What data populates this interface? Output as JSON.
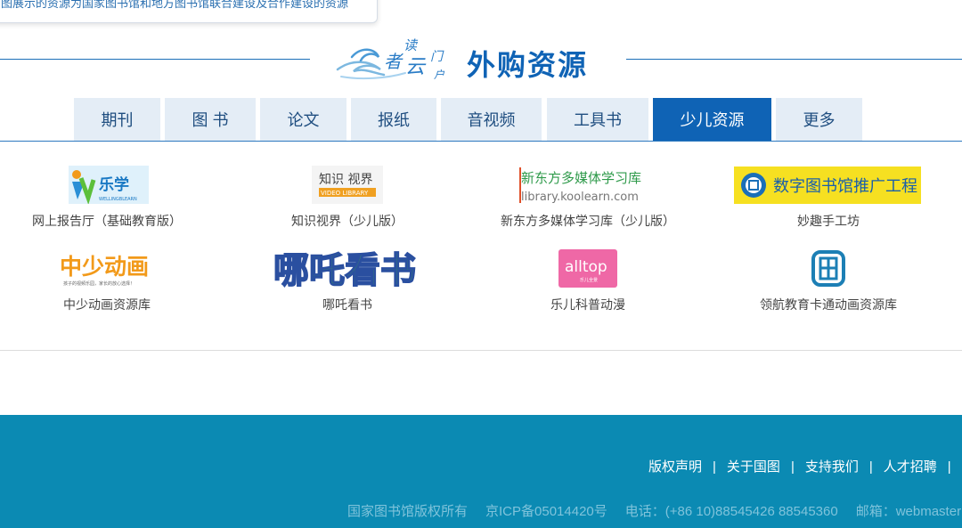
{
  "notice": {
    "text": "图展示的资源为国家图书馆和地方图书馆联合建设及合作建设的资源"
  },
  "header": {
    "logo_text": "读者之门",
    "title": "外购资源"
  },
  "tabs": [
    {
      "label": "期刊"
    },
    {
      "label": "图 书"
    },
    {
      "label": "论文"
    },
    {
      "label": "报纸"
    },
    {
      "label": "音视频"
    },
    {
      "label": "工具书"
    },
    {
      "label": "少儿资源",
      "active": true
    },
    {
      "label": "更多"
    }
  ],
  "resources": [
    {
      "name": "网上报告厅（基础教育版）",
      "logo_text": "乐学",
      "logo_sub": "WELLINGBLEARN"
    },
    {
      "name": "知识视界（少儿版）",
      "logo_text": "知识 视界",
      "logo_sub": "VIDEO LIBRARY"
    },
    {
      "name": "新东方多媒体学习库（少儿版）",
      "logo_text": "新东方多媒体学习库",
      "logo_sub": "library.koolearn.com"
    },
    {
      "name": "妙趣手工坊",
      "logo_text": "数字图书馆推广工程"
    },
    {
      "name": "中少动画资源库",
      "logo_text": "中少动画",
      "logo_sub": "孩子的视频乐园，家长的放心选择！"
    },
    {
      "name": "哪吒看书",
      "logo_text": "哪吒看书"
    },
    {
      "name": "乐儿科普动漫",
      "logo_text": "alltop",
      "logo_sub": "乐儿全景"
    },
    {
      "name": "领航教育卡通动画资源库",
      "logo_text": ""
    }
  ],
  "footer": {
    "links": [
      "版权声明",
      "关于国图",
      "支持我们",
      "人才招聘"
    ],
    "copyright": "国家图书馆版权所有",
    "icp": "京ICP备05014420号",
    "phone": "电话：(+86 10)88545426 88545360",
    "email": "邮箱：webmaster"
  },
  "colors": {
    "brand_blue": "#0f63b5",
    "tab_bg": "#e4edf6",
    "footer_bg": "#0b8ab3"
  }
}
